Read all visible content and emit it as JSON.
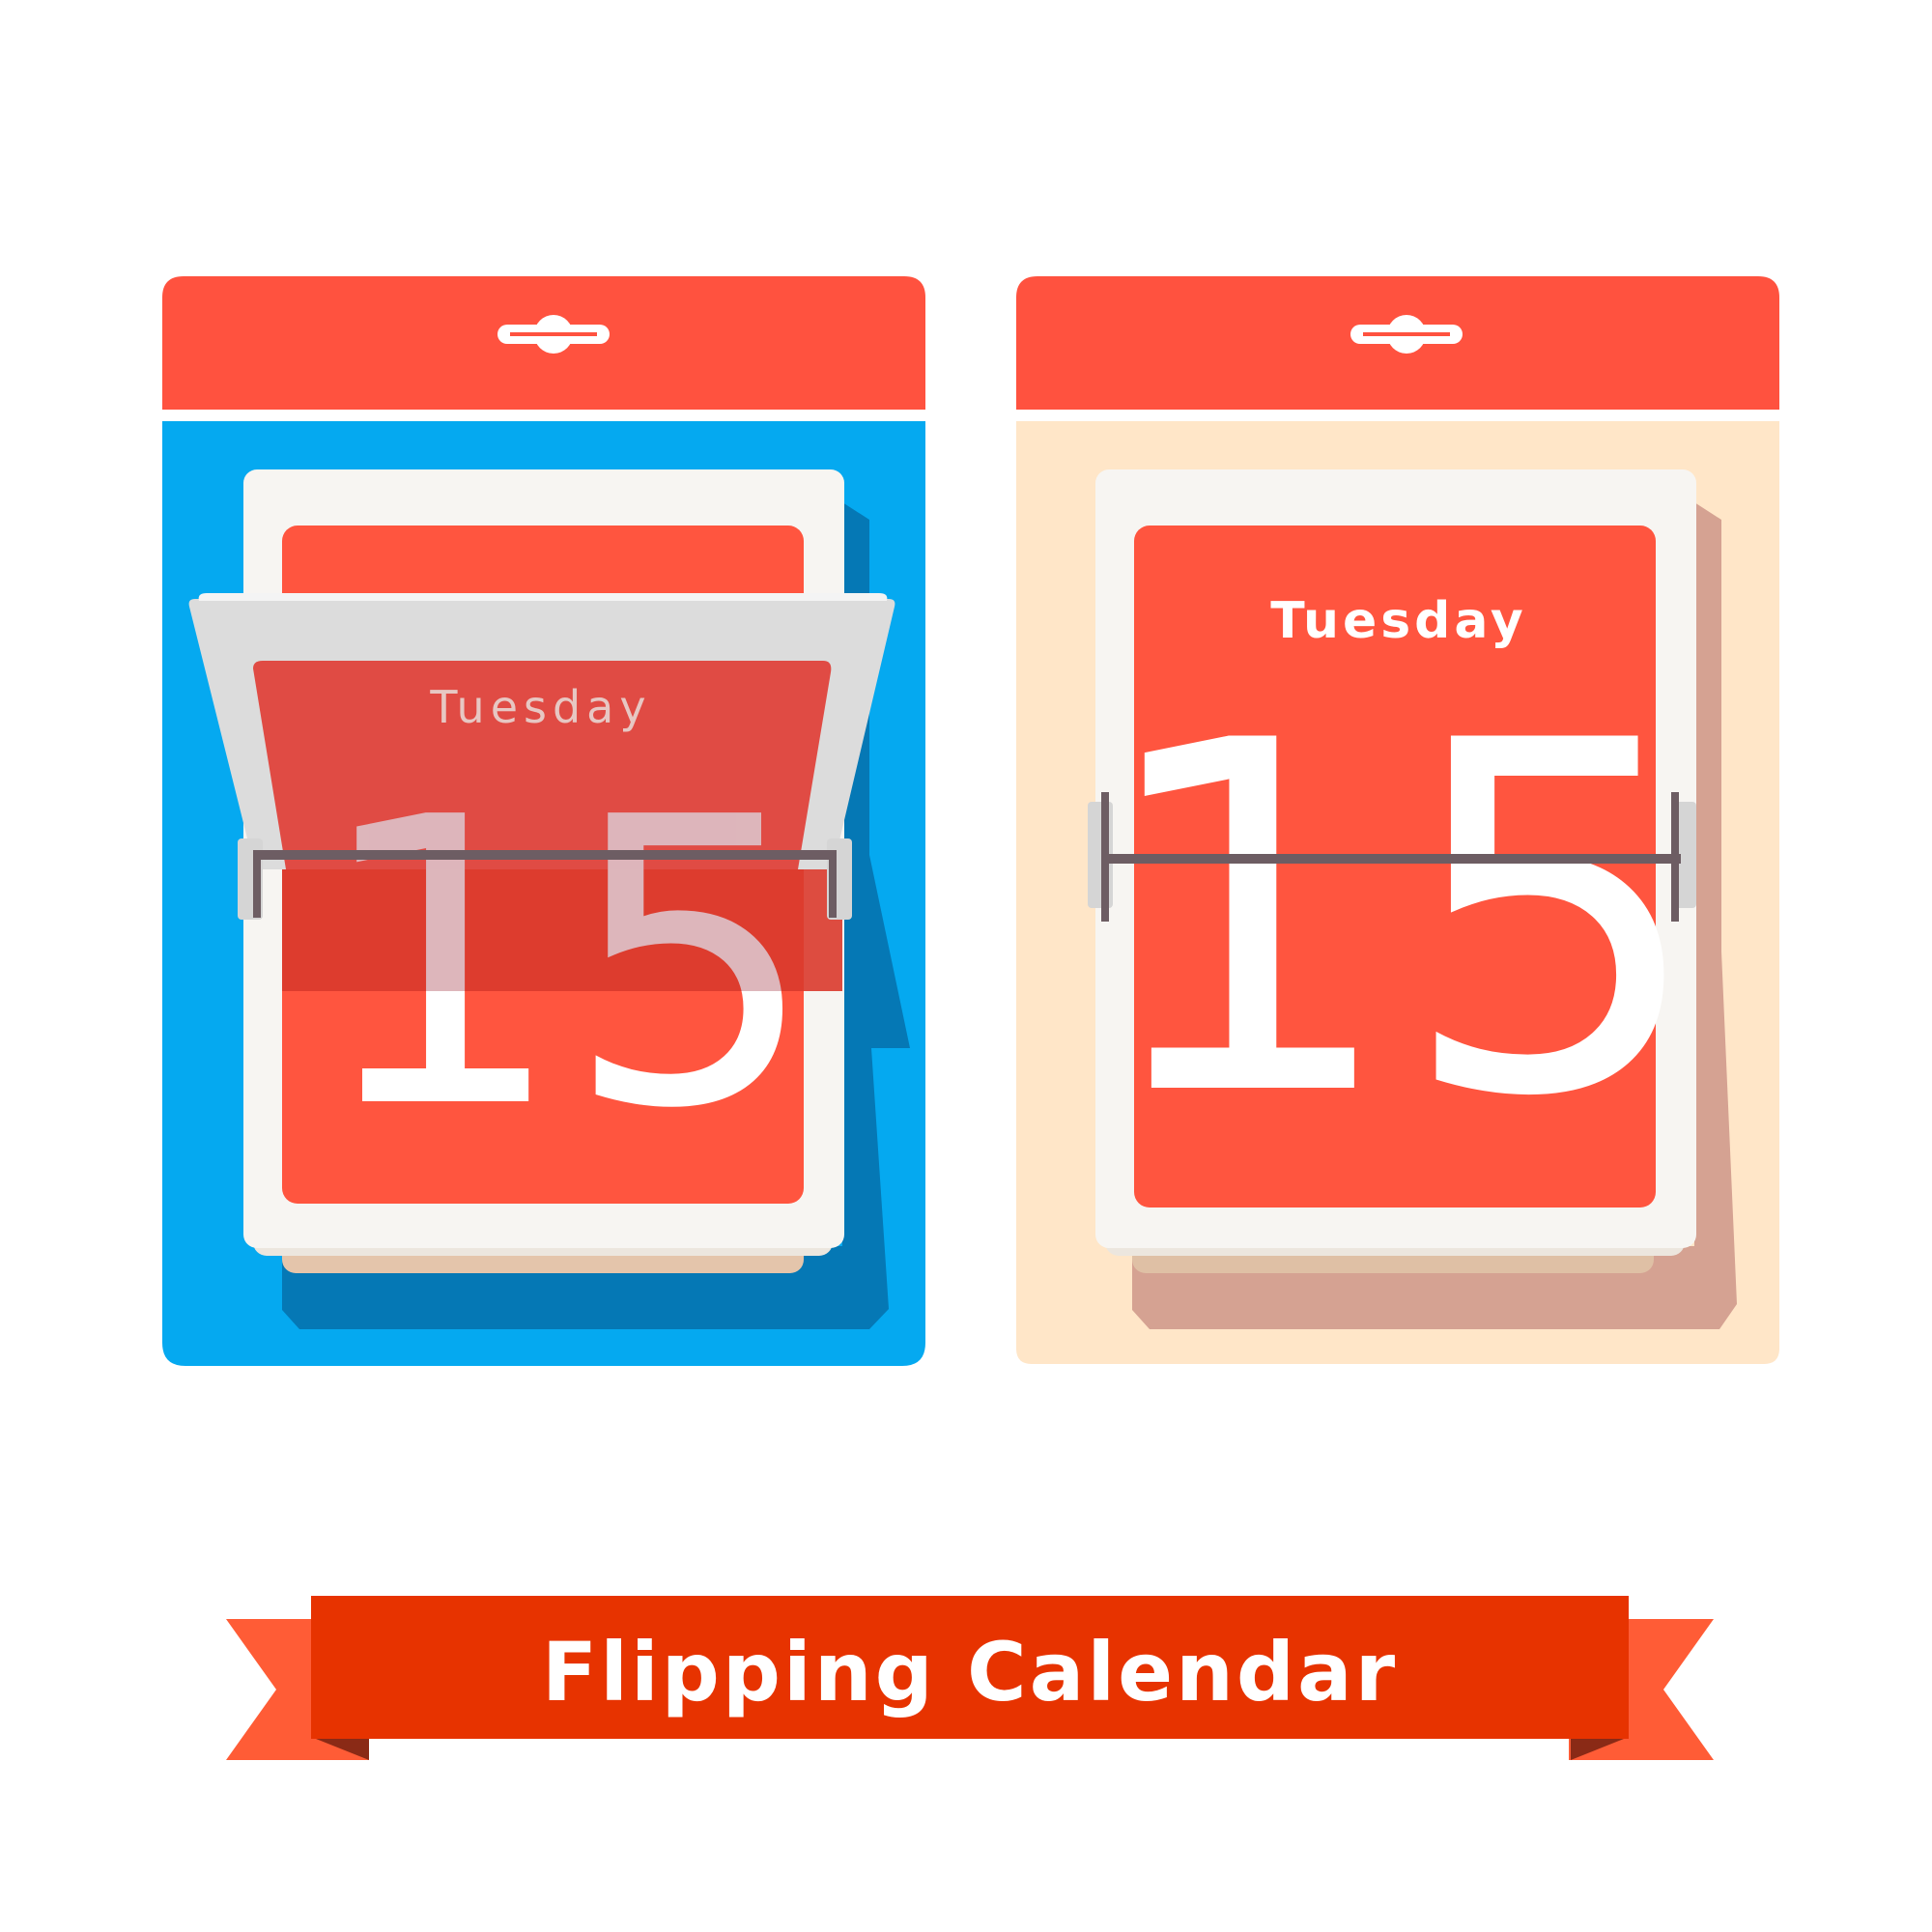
{
  "colors": {
    "header_red": "#ff523f",
    "page_red": "#ff553f",
    "blue_board": "#05a9f0",
    "blue_shadow": "#0578b5",
    "cream_board": "#ffe6c8",
    "cream_shadow": "#d5a292",
    "banner_red": "#e73300",
    "ribbon_tail": "#ff5c36",
    "hinge_rod": "#6d5d63"
  },
  "left_calendar": {
    "weekday": "Tuesday",
    "day": "15",
    "state": "flipping"
  },
  "right_calendar": {
    "weekday": "Tuesday",
    "day": "15",
    "state": "resting"
  },
  "banner": {
    "title": "Flipping Calendar"
  }
}
